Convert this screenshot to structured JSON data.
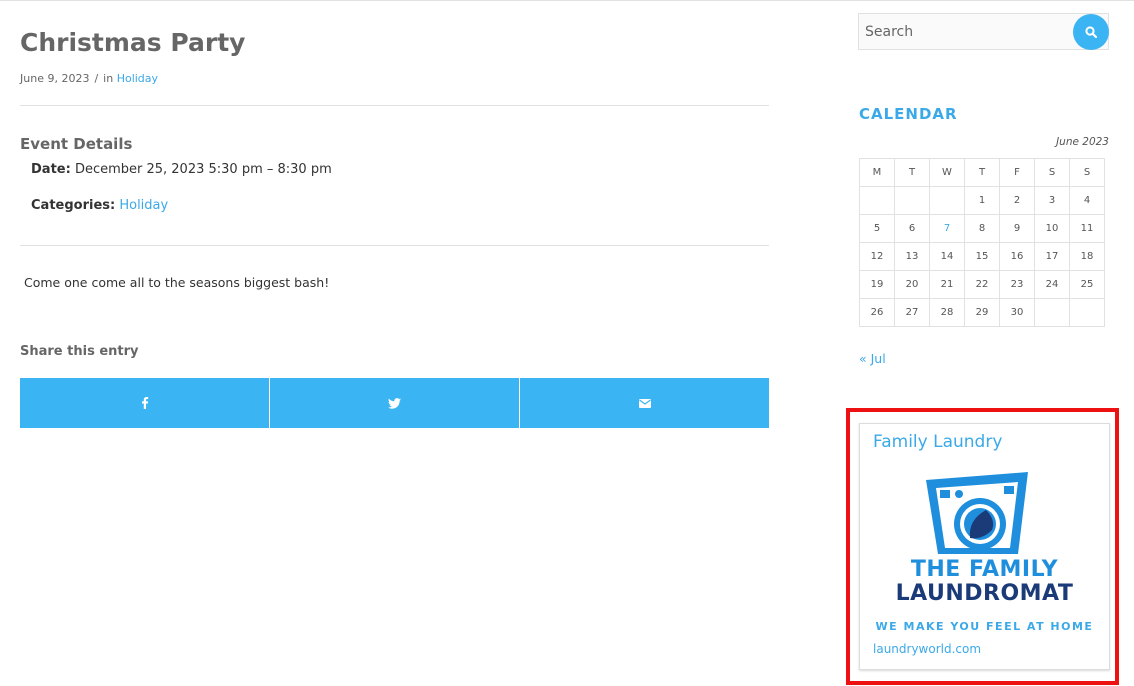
{
  "post": {
    "title": "Christmas Party",
    "date": "June 9, 2023",
    "separator": "/",
    "in_label": "in",
    "category": "Holiday"
  },
  "event": {
    "heading": "Event Details",
    "date_label": "Date:",
    "date_value": "December 25, 2023 5:30 pm – 8:30 pm",
    "categories_label": "Categories:",
    "categories_value": "Holiday"
  },
  "description": "Come one come all to the seasons biggest bash!",
  "share": {
    "heading": "Share this entry",
    "buttons": [
      {
        "icon": "facebook-icon"
      },
      {
        "icon": "twitter-icon"
      },
      {
        "icon": "mail-icon"
      }
    ],
    "color": "#3bb4f4"
  },
  "search": {
    "placeholder": "Search",
    "icon": "search-icon"
  },
  "calendar": {
    "title": "CALENDAR",
    "caption": "June 2023",
    "weekdays": [
      "M",
      "T",
      "W",
      "T",
      "F",
      "S",
      "S"
    ],
    "weeks": [
      [
        "",
        "",
        "",
        "1",
        "2",
        "3",
        "4"
      ],
      [
        "5",
        "6",
        "7",
        "8",
        "9",
        "10",
        "11"
      ],
      [
        "12",
        "13",
        "14",
        "15",
        "16",
        "17",
        "18"
      ],
      [
        "19",
        "20",
        "21",
        "22",
        "23",
        "24",
        "25"
      ],
      [
        "26",
        "27",
        "28",
        "29",
        "30",
        "",
        ""
      ]
    ],
    "linked_day": "7",
    "prev_link": "« Jul"
  },
  "ad": {
    "title": "Family Laundry",
    "logo_line1": "THE FAMILY",
    "logo_line2": "LAUNDROMAT",
    "tagline": "WE MAKE YOU FEEL AT HOME",
    "url": "laundryworld.com",
    "logo_icon": "washing-machine-icon",
    "highlight_color": "#ee1111"
  },
  "colors": {
    "accent": "#3ba9e8",
    "heading": "#666666"
  }
}
